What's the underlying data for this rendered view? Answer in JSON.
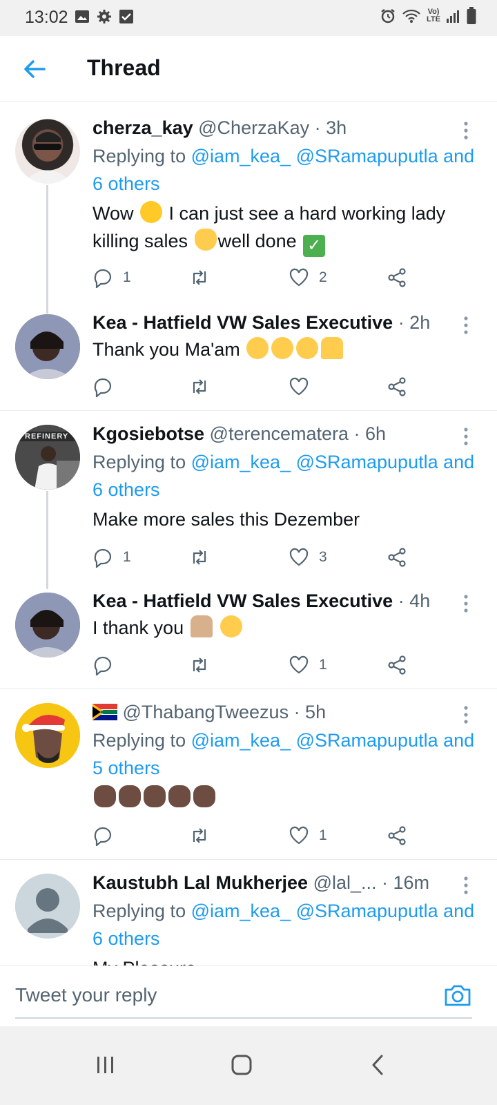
{
  "status_bar": {
    "time": "13:02",
    "network": "LTE"
  },
  "header": {
    "title": "Thread"
  },
  "tweets": [
    {
      "name": "cherza_kay",
      "meta": "@CherzaKay · 3h",
      "reply_prefix": "Replying to",
      "reply_links": "@iam_kea_ @SRamapuputla",
      "reply_others": "and 6 others",
      "text_a": "Wow",
      "text_b": "I can just see a hard working lady killing sales",
      "text_c": "well done",
      "reply_count": "1",
      "retweet_count": "",
      "like_count": "2"
    },
    {
      "name": "Kea - Hatfield VW Sales Executive",
      "meta": "· 2h",
      "text_a": "Thank you Ma'am",
      "reply_count": "",
      "retweet_count": "",
      "like_count": ""
    },
    {
      "name": "Kgosiebotse",
      "meta": "@terencematera · 6h",
      "reply_prefix": "Replying to",
      "reply_links": "@iam_kea_ @SRamapuputla",
      "reply_others": "and 6 others",
      "text_a": "Make more sales this Dezember",
      "reply_count": "1",
      "retweet_count": "",
      "like_count": "3",
      "avatar_label": "REFINERY"
    },
    {
      "name": "Kea - Hatfield VW Sales Executive",
      "meta": "· 4h",
      "text_a": "I thank you",
      "reply_count": "",
      "retweet_count": "",
      "like_count": "1"
    },
    {
      "name": "",
      "meta": "@ThabangTweezus · 5h",
      "reply_prefix": "Replying to",
      "reply_links": "@iam_kea_ @SRamapuputla",
      "reply_others": "and 5 others",
      "reply_count": "",
      "retweet_count": "",
      "like_count": "1"
    },
    {
      "name": "Kaustubh Lal Mukherjee",
      "meta": "@lal_... · 16m",
      "reply_prefix": "Replying to",
      "reply_links": "@iam_kea_ @SRamapuputla",
      "reply_others": "and 6 others",
      "text_a": "My Pleasure"
    }
  ],
  "composer": {
    "placeholder": "Tweet your reply"
  },
  "icons": {
    "back": "arrow-left-icon",
    "more": "more-vertical-icon",
    "reply": "comment-icon",
    "retweet": "retweet-icon",
    "like": "heart-icon",
    "share": "share-icon",
    "camera": "camera-icon"
  },
  "colors": {
    "accent": "#1d9bf0",
    "text": "#0f1419",
    "muted": "#536471",
    "divider": "#e6ecf0"
  }
}
